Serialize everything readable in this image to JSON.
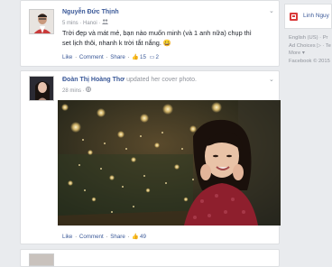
{
  "posts": [
    {
      "author": "Nguyễn Đức Thịnh",
      "time": "5 mins",
      "location": "Hanoi",
      "privacy_icon": "friends-icon",
      "text_line1": "Trời đẹp và mát mẻ, bạn nào muốn minh (và 1 anh nữa) chụp thì",
      "text_line2": "set lịch thôi, nhanh k trời tắt nắng. 😀",
      "actions": {
        "like": "Like",
        "comment": "Comment",
        "share": "Share"
      },
      "like_count": "15",
      "comment_count": "2"
    },
    {
      "author": "Đoàn Thị Hoàng Thơ",
      "action_text": "updated her cover photo.",
      "time": "28 mins",
      "privacy_icon": "public-icon",
      "actions": {
        "like": "Like",
        "comment": "Comment",
        "share": "Share"
      },
      "like_count": "49"
    }
  ],
  "sidebar": {
    "page_name": "Linh Nguy",
    "footer_line1": "English (US) · Pr",
    "footer_line2": "Ad Choices ▷ · Te",
    "footer_line3": "More ▾",
    "footer_line4": "Facebook © 2015"
  },
  "separator": "·",
  "colors": {
    "link": "#3b5998",
    "meta": "#90949c",
    "background": "#e9ebee"
  }
}
